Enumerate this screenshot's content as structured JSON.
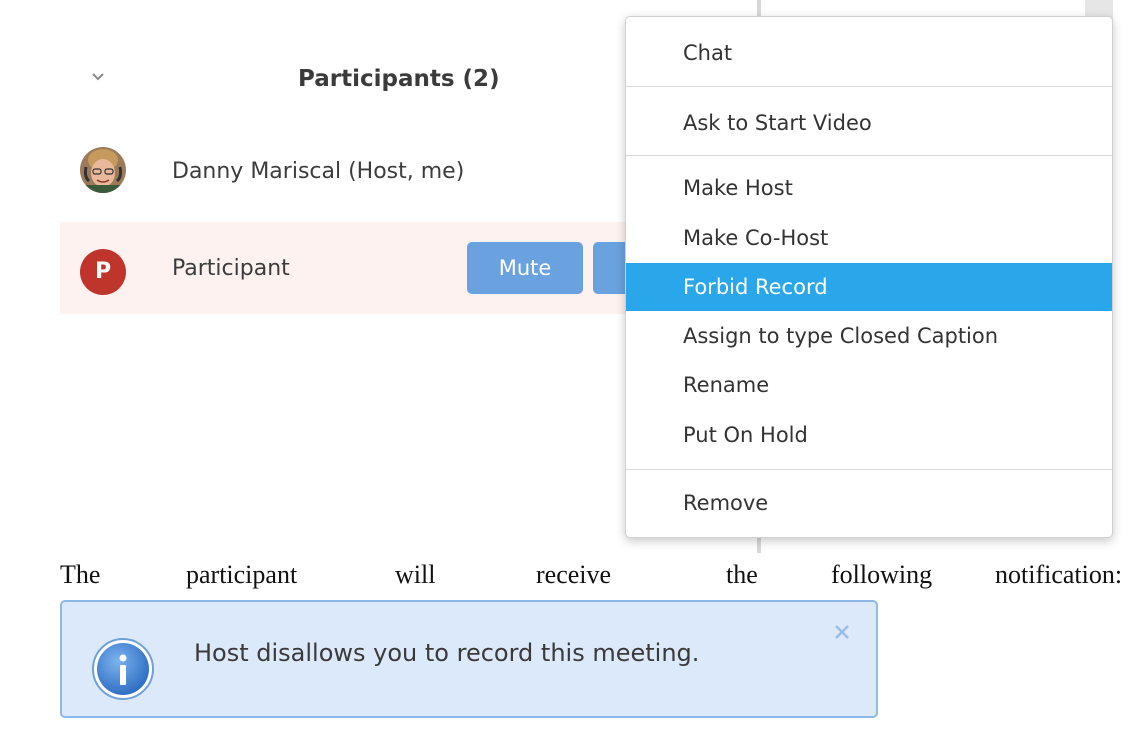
{
  "panel": {
    "title": "Participants (2)",
    "participants": [
      {
        "name": "Danny Mariscal (Host, me)",
        "avatar": "photo-avatar"
      },
      {
        "name": "Participant",
        "avatar_letter": "P",
        "avatar_color": "#c0352b"
      }
    ],
    "mute_label": "Mute",
    "button_color": "#6aa2df",
    "row_highlight_color": "#fdf2ef"
  },
  "menu": {
    "items": [
      {
        "label": "Chat"
      },
      {
        "label": "Ask to Start Video"
      },
      {
        "label": "Make Host"
      },
      {
        "label": "Make Co-Host"
      },
      {
        "label": "Forbid Record",
        "highlighted": true
      },
      {
        "label": "Assign to type Closed Caption"
      },
      {
        "label": "Rename"
      },
      {
        "label": "Put On Hold"
      },
      {
        "label": "Remove"
      }
    ],
    "highlight_color": "#2aa7ea"
  },
  "doc": {
    "words": [
      "The",
      "participant",
      "will",
      "receive",
      "the",
      "following",
      "notification:"
    ]
  },
  "notification": {
    "text": "Host disallows you to record this meeting.",
    "icon": "info-icon",
    "close_icon": "close-icon",
    "background": "#dbe9fb"
  }
}
